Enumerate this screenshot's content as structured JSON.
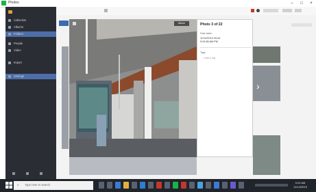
{
  "window": {
    "title": "Photos",
    "controls": {
      "minimize": "–",
      "maximize": "□",
      "close": "×"
    }
  },
  "sidebar": {
    "items": [
      {
        "label": "Collection",
        "selected": false
      },
      {
        "label": "Albums",
        "selected": false
      },
      {
        "label": "Folders",
        "selected": true
      },
      {
        "label": "People",
        "selected": false
      },
      {
        "label": "Video",
        "selected": false
      },
      {
        "label": "Import",
        "selected": false
      },
      {
        "label": "Settings",
        "selected": true
      }
    ]
  },
  "viewer": {
    "button_label": "Album",
    "close_label": "×",
    "prev_label": "‹",
    "next_label": "›"
  },
  "info_panel": {
    "title": "Photo 3 of 22",
    "date_label": "Date taken",
    "date_line1": "11/14/2019 09:44",
    "date_line2": "9:24:56 AM PM",
    "tags_label": "Tags",
    "tags_add": "+ Add a tag"
  },
  "taskbar": {
    "search_placeholder": "Type here to search",
    "time": "9:24 AM",
    "date": "11/14/2019"
  },
  "colors": {
    "sidebar_bg": "#2a2d34",
    "sidebar_selected": "#4d6ea8",
    "taskbar_bg": "#20242b",
    "app_accent": "#1bb24a"
  }
}
